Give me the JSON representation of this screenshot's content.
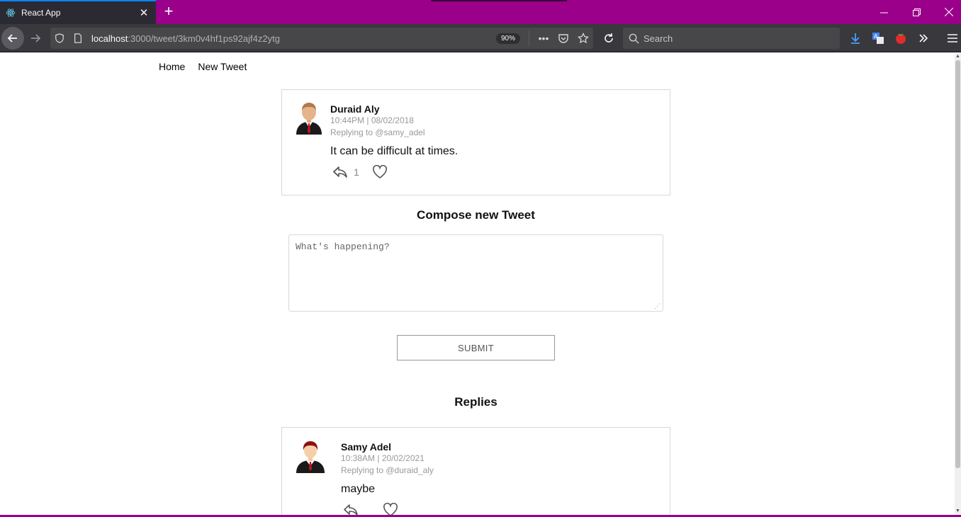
{
  "browser": {
    "tab_title": "React App",
    "url_host": "localhost",
    "url_path": ":3000/tweet/3km0v4hf1ps92ajf4z2ytg",
    "zoom": "90%",
    "search_placeholder": "Search",
    "accent_color": "#9a0089"
  },
  "nav": {
    "home": "Home",
    "new_tweet": "New Tweet"
  },
  "parent_tweet": {
    "author": "Duraid Aly",
    "timestamp": "10:44PM | 08/02/2018",
    "replying_to": "Replying to @samy_adel",
    "text": "It can be difficult at times.",
    "reply_count": "1"
  },
  "compose": {
    "title": "Compose new Tweet",
    "placeholder": "What's happening?",
    "submit_label": "SUBMIT"
  },
  "replies": {
    "title": "Replies",
    "items": [
      {
        "author": "Samy Adel",
        "timestamp": "10:38AM | 20/02/2021",
        "replying_to": "Replying to @duraid_aly",
        "text": "maybe"
      }
    ]
  }
}
